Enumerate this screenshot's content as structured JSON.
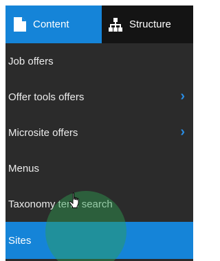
{
  "tabs": [
    {
      "label": "Content",
      "icon": "document-icon",
      "active": true
    },
    {
      "label": "Structure",
      "icon": "sitemap-icon",
      "active": false
    }
  ],
  "menu": {
    "items": [
      {
        "label": "Job offers",
        "has_submenu": false,
        "active": false
      },
      {
        "label": "Offer tools offers",
        "has_submenu": true,
        "active": false
      },
      {
        "label": "Microsite offers",
        "has_submenu": true,
        "active": false
      },
      {
        "label": "Menus",
        "has_submenu": false,
        "active": false
      },
      {
        "label": "Taxonomy term search",
        "has_submenu": false,
        "active": false
      },
      {
        "label": "Sites",
        "has_submenu": false,
        "active": true
      }
    ],
    "submenu_chevron": "›"
  },
  "cursor": {
    "type": "hand-pointer-icon"
  },
  "colors": {
    "accent": "#1584d8",
    "menu_background": "#2b2b2b",
    "tab_dark": "#141414",
    "chevron": "#2a8ee6",
    "click_highlight": "#2ea052"
  }
}
